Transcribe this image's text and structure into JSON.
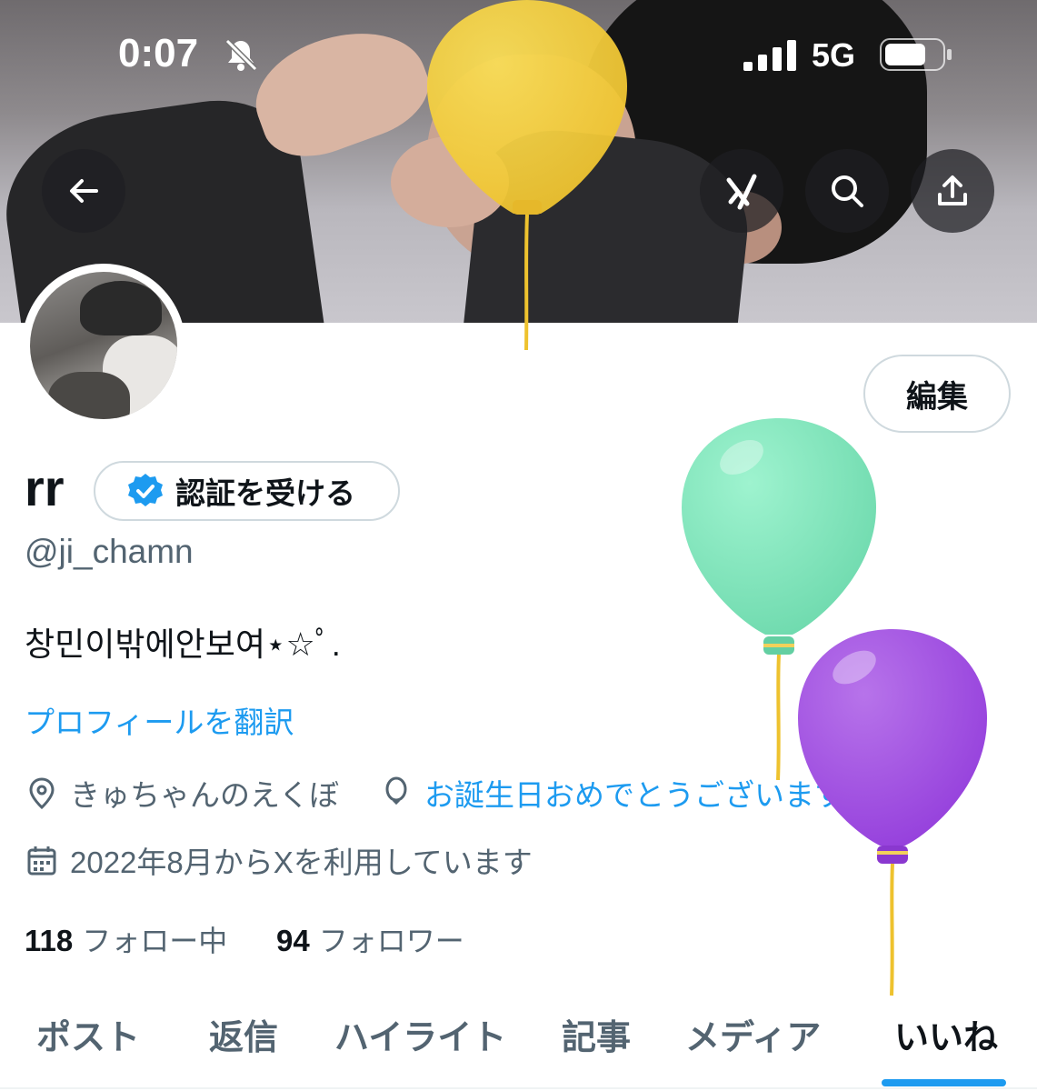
{
  "status_bar": {
    "time": "0:07",
    "network": "5G"
  },
  "profile": {
    "edit_label": "編集",
    "display_name": "rr",
    "verify_label": "認証を受ける",
    "handle": "@ji_chamn",
    "bio": "창민이밖에안보여⋆☆ﾟ.",
    "translate_label": "プロフィールを翻訳",
    "location": "きゅちゃんのえくぼ",
    "birthday": "お誕生日おめでとうございます。",
    "joined": "2022年8月からXを利用しています",
    "following_count": "118",
    "following_label": "フォロー中",
    "followers_count": "94",
    "followers_label": "フォロワー"
  },
  "tabs": [
    {
      "label": "ポスト"
    },
    {
      "label": "返信"
    },
    {
      "label": "ハイライト"
    },
    {
      "label": "記事"
    },
    {
      "label": "メディア"
    },
    {
      "label": "いいね",
      "active": true
    }
  ],
  "colors": {
    "accent": "#1d9bf0",
    "secondary_text": "#536471",
    "border": "#cfd9de"
  },
  "icons": {
    "back": "arrow-left-icon",
    "grok": "grok-icon",
    "search": "search-icon",
    "share": "share-icon",
    "location": "location-pin-icon",
    "birthday": "balloon-icon",
    "calendar": "calendar-icon",
    "verified": "verified-badge-icon"
  }
}
